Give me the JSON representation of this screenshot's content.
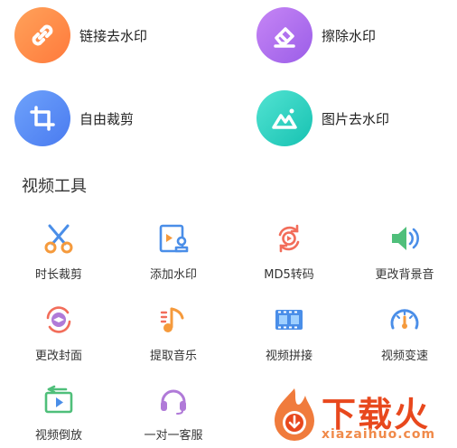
{
  "top_tools": [
    {
      "label": "链接去水印",
      "icon": "link-icon"
    },
    {
      "label": "擦除水印",
      "icon": "eraser-icon"
    },
    {
      "label": "自由裁剪",
      "icon": "crop-icon"
    },
    {
      "label": "图片去水印",
      "icon": "image-icon"
    }
  ],
  "section": {
    "title": "视频工具"
  },
  "video_tools": [
    {
      "label": "时长裁剪",
      "icon": "scissors-icon"
    },
    {
      "label": "添加水印",
      "icon": "watermark-add-icon"
    },
    {
      "label": "MD5转码",
      "icon": "md5-refresh-icon"
    },
    {
      "label": "更改背景音",
      "icon": "speaker-icon"
    },
    {
      "label": "更改封面",
      "icon": "cover-icon"
    },
    {
      "label": "提取音乐",
      "icon": "music-note-icon"
    },
    {
      "label": "视频拼接",
      "icon": "film-strip-icon"
    },
    {
      "label": "视频变速",
      "icon": "speedometer-icon"
    },
    {
      "label": "视频倒放",
      "icon": "reverse-play-icon"
    },
    {
      "label": "一对一客服",
      "icon": "headset-icon"
    }
  ],
  "watermark": {
    "text": "下载火",
    "url": "xiazaihuo.com"
  },
  "colors": {
    "orange": "#ff8a45",
    "purple": "#a86cf0",
    "blue": "#5a8cf6",
    "teal": "#2fd4c3",
    "icon_orange": "#f59a3c",
    "icon_blue": "#4a8ee8",
    "icon_red": "#f26d5a",
    "icon_green": "#4fbf7a",
    "icon_purple": "#b07ad8"
  }
}
